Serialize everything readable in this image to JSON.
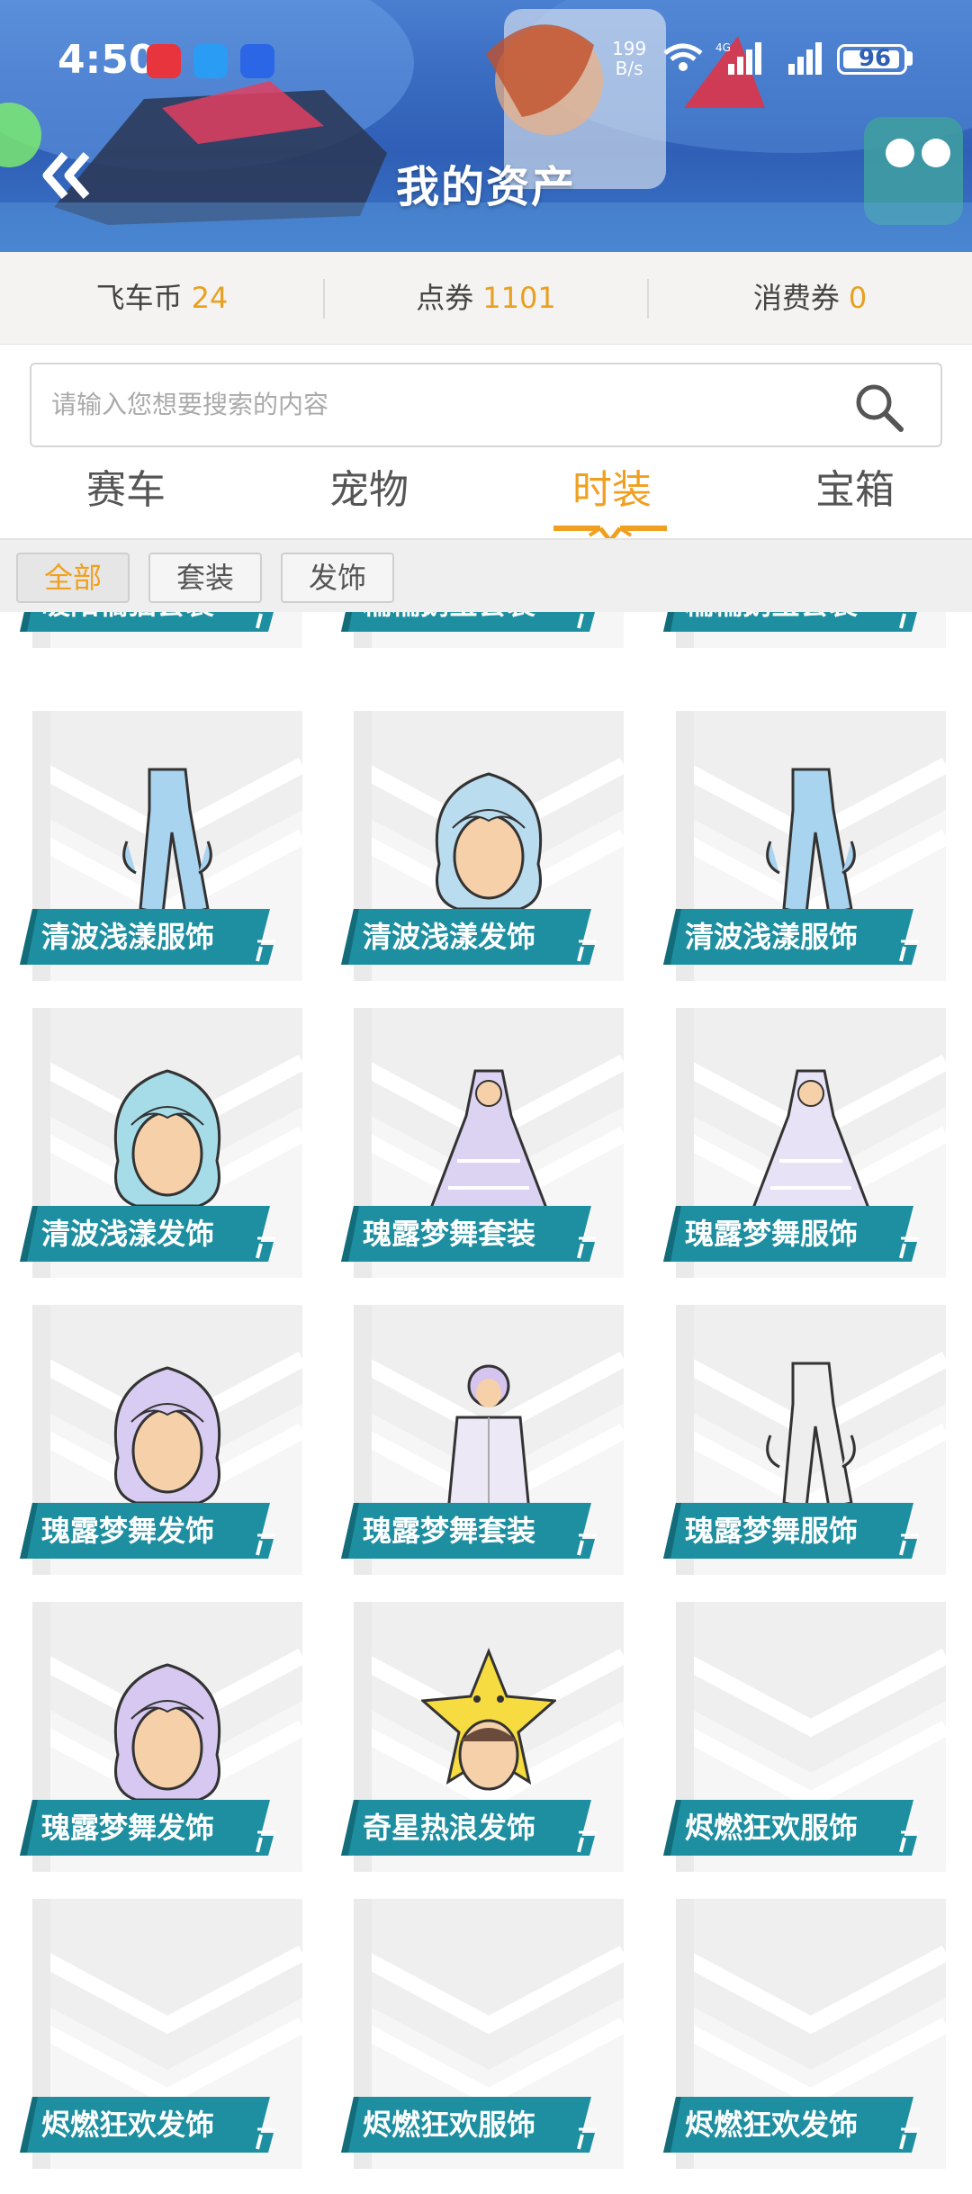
{
  "status_bar": {
    "time": "4:50",
    "net_speed": "199",
    "net_unit": "B/s",
    "battery": "96"
  },
  "header": {
    "title": "我的资产"
  },
  "currencies": [
    {
      "label": "飞车币",
      "value": "24"
    },
    {
      "label": "点券",
      "value": "1101"
    },
    {
      "label": "消费券",
      "value": "0"
    }
  ],
  "search": {
    "placeholder": "请输入您想要搜索的内容"
  },
  "tabs": [
    {
      "label": "赛车"
    },
    {
      "label": "宠物"
    },
    {
      "label": "时装",
      "active": true
    },
    {
      "label": "宝箱"
    }
  ],
  "filters": [
    {
      "label": "全部",
      "active": true
    },
    {
      "label": "套装"
    },
    {
      "label": "发饰"
    }
  ],
  "items": [
    {
      "name": "暖阳橘猫套装",
      "icon": ""
    },
    {
      "name": "糯糯鹅宝套装",
      "icon": ""
    },
    {
      "name": "糯糯鹅宝套装",
      "icon": ""
    },
    {
      "name": "清波浅漾服饰",
      "icon": "outfit-icon",
      "color": "#a9d4ef"
    },
    {
      "name": "清波浅漾发饰",
      "icon": "hair-icon",
      "color": "#b9dcef"
    },
    {
      "name": "清波浅漾服饰",
      "icon": "outfit-icon",
      "color": "#a9d4ef"
    },
    {
      "name": "清波浅漾发饰",
      "icon": "hair-icon",
      "color": "#a6dbe8"
    },
    {
      "name": "瑰露梦舞套装",
      "icon": "dress-icon",
      "color": "#dcd2f2"
    },
    {
      "name": "瑰露梦舞服饰",
      "icon": "dress-icon",
      "color": "#e8e2f6"
    },
    {
      "name": "瑰露梦舞发饰",
      "icon": "hair-icon",
      "color": "#d8ccf2"
    },
    {
      "name": "瑰露梦舞套装",
      "icon": "suit-icon",
      "color": "#ece8f6"
    },
    {
      "name": "瑰露梦舞服饰",
      "icon": "outfit-icon",
      "color": "#eeeeee"
    },
    {
      "name": "瑰露梦舞发饰",
      "icon": "hair-icon",
      "color": "#d6c8f0"
    },
    {
      "name": "奇星热浪发饰",
      "icon": "star-hat-icon",
      "color": "#f6dc40"
    },
    {
      "name": "烬燃狂欢服饰",
      "icon": ""
    },
    {
      "name": "烬燃狂欢发饰",
      "icon": ""
    },
    {
      "name": "烬燃狂欢服饰",
      "icon": ""
    },
    {
      "name": "烬燃狂欢发饰",
      "icon": ""
    }
  ]
}
